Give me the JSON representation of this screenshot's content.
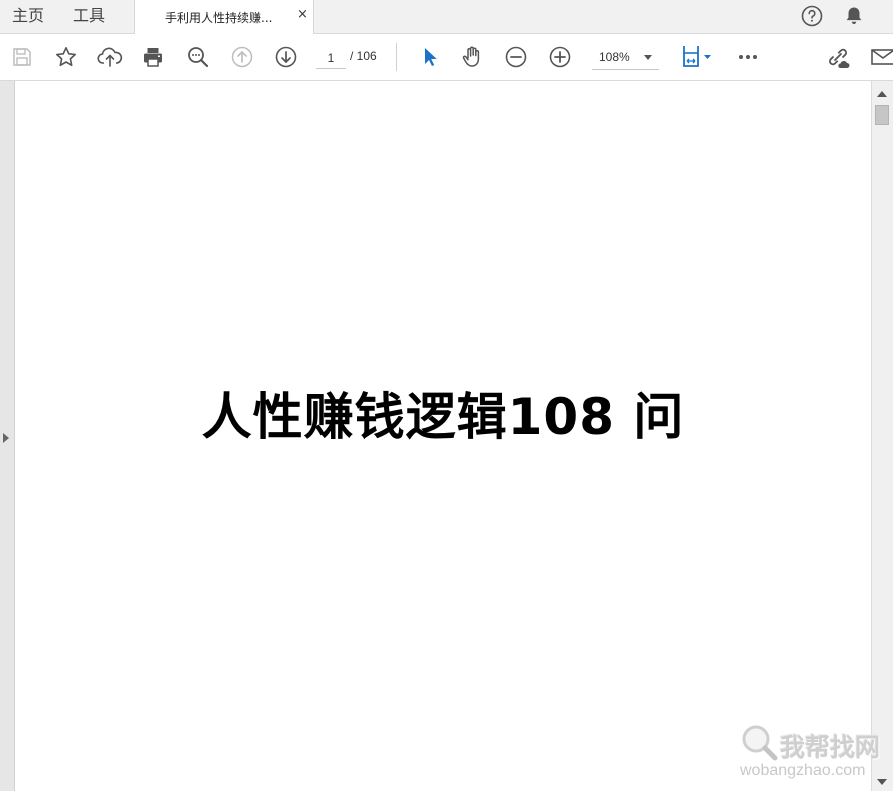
{
  "tabs": {
    "home_label": "主页",
    "tools_label": "工具",
    "document_title": "手利用人性持续赚...",
    "close_glyph": "×"
  },
  "toolbar": {
    "current_page": "1",
    "page_total": "/ 106",
    "zoom_value": "108%"
  },
  "document": {
    "heading": "人性赚钱逻辑108 问"
  },
  "watermark": {
    "site_name_cn": "我帮找网",
    "site_domain": "wobangzhao.com"
  },
  "colors": {
    "accent_blue": "#1a73c8",
    "icon_gray": "#555555",
    "disabled_gray": "#bdbdbd",
    "tabbar_bg": "#f1f1f1"
  }
}
